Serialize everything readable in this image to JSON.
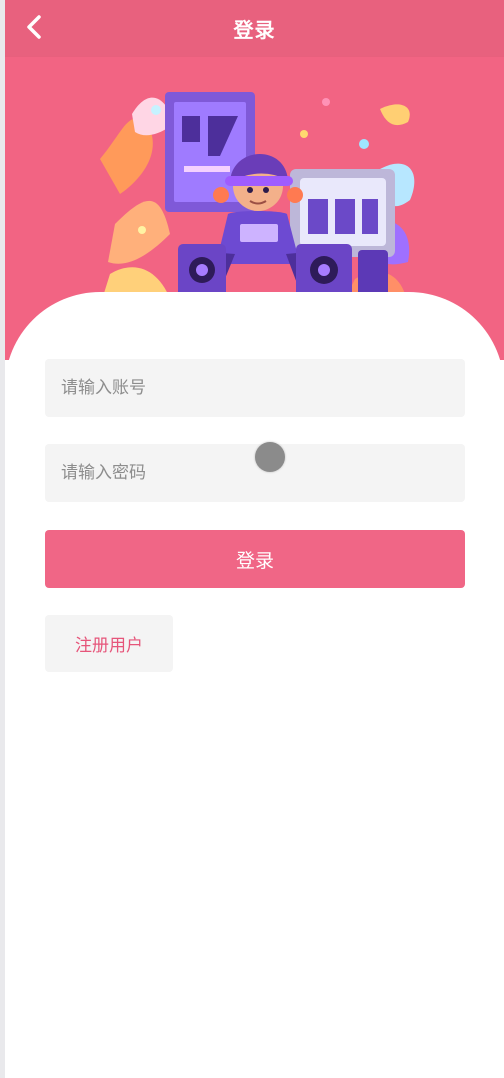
{
  "nav": {
    "title": "登录",
    "back_icon": "chevron-left-icon"
  },
  "hero": {
    "illustration_icon": "music-character-illustration"
  },
  "form": {
    "account_placeholder": "请输入账号",
    "password_placeholder": "请输入密码",
    "login_label": "登录",
    "register_label": "注册用户"
  },
  "colors": {
    "brand_pink": "#f26483",
    "nav_pink": "#e8617e",
    "button_pink": "#f06686",
    "register_text": "#e6557a",
    "field_bg": "#f4f4f4"
  }
}
